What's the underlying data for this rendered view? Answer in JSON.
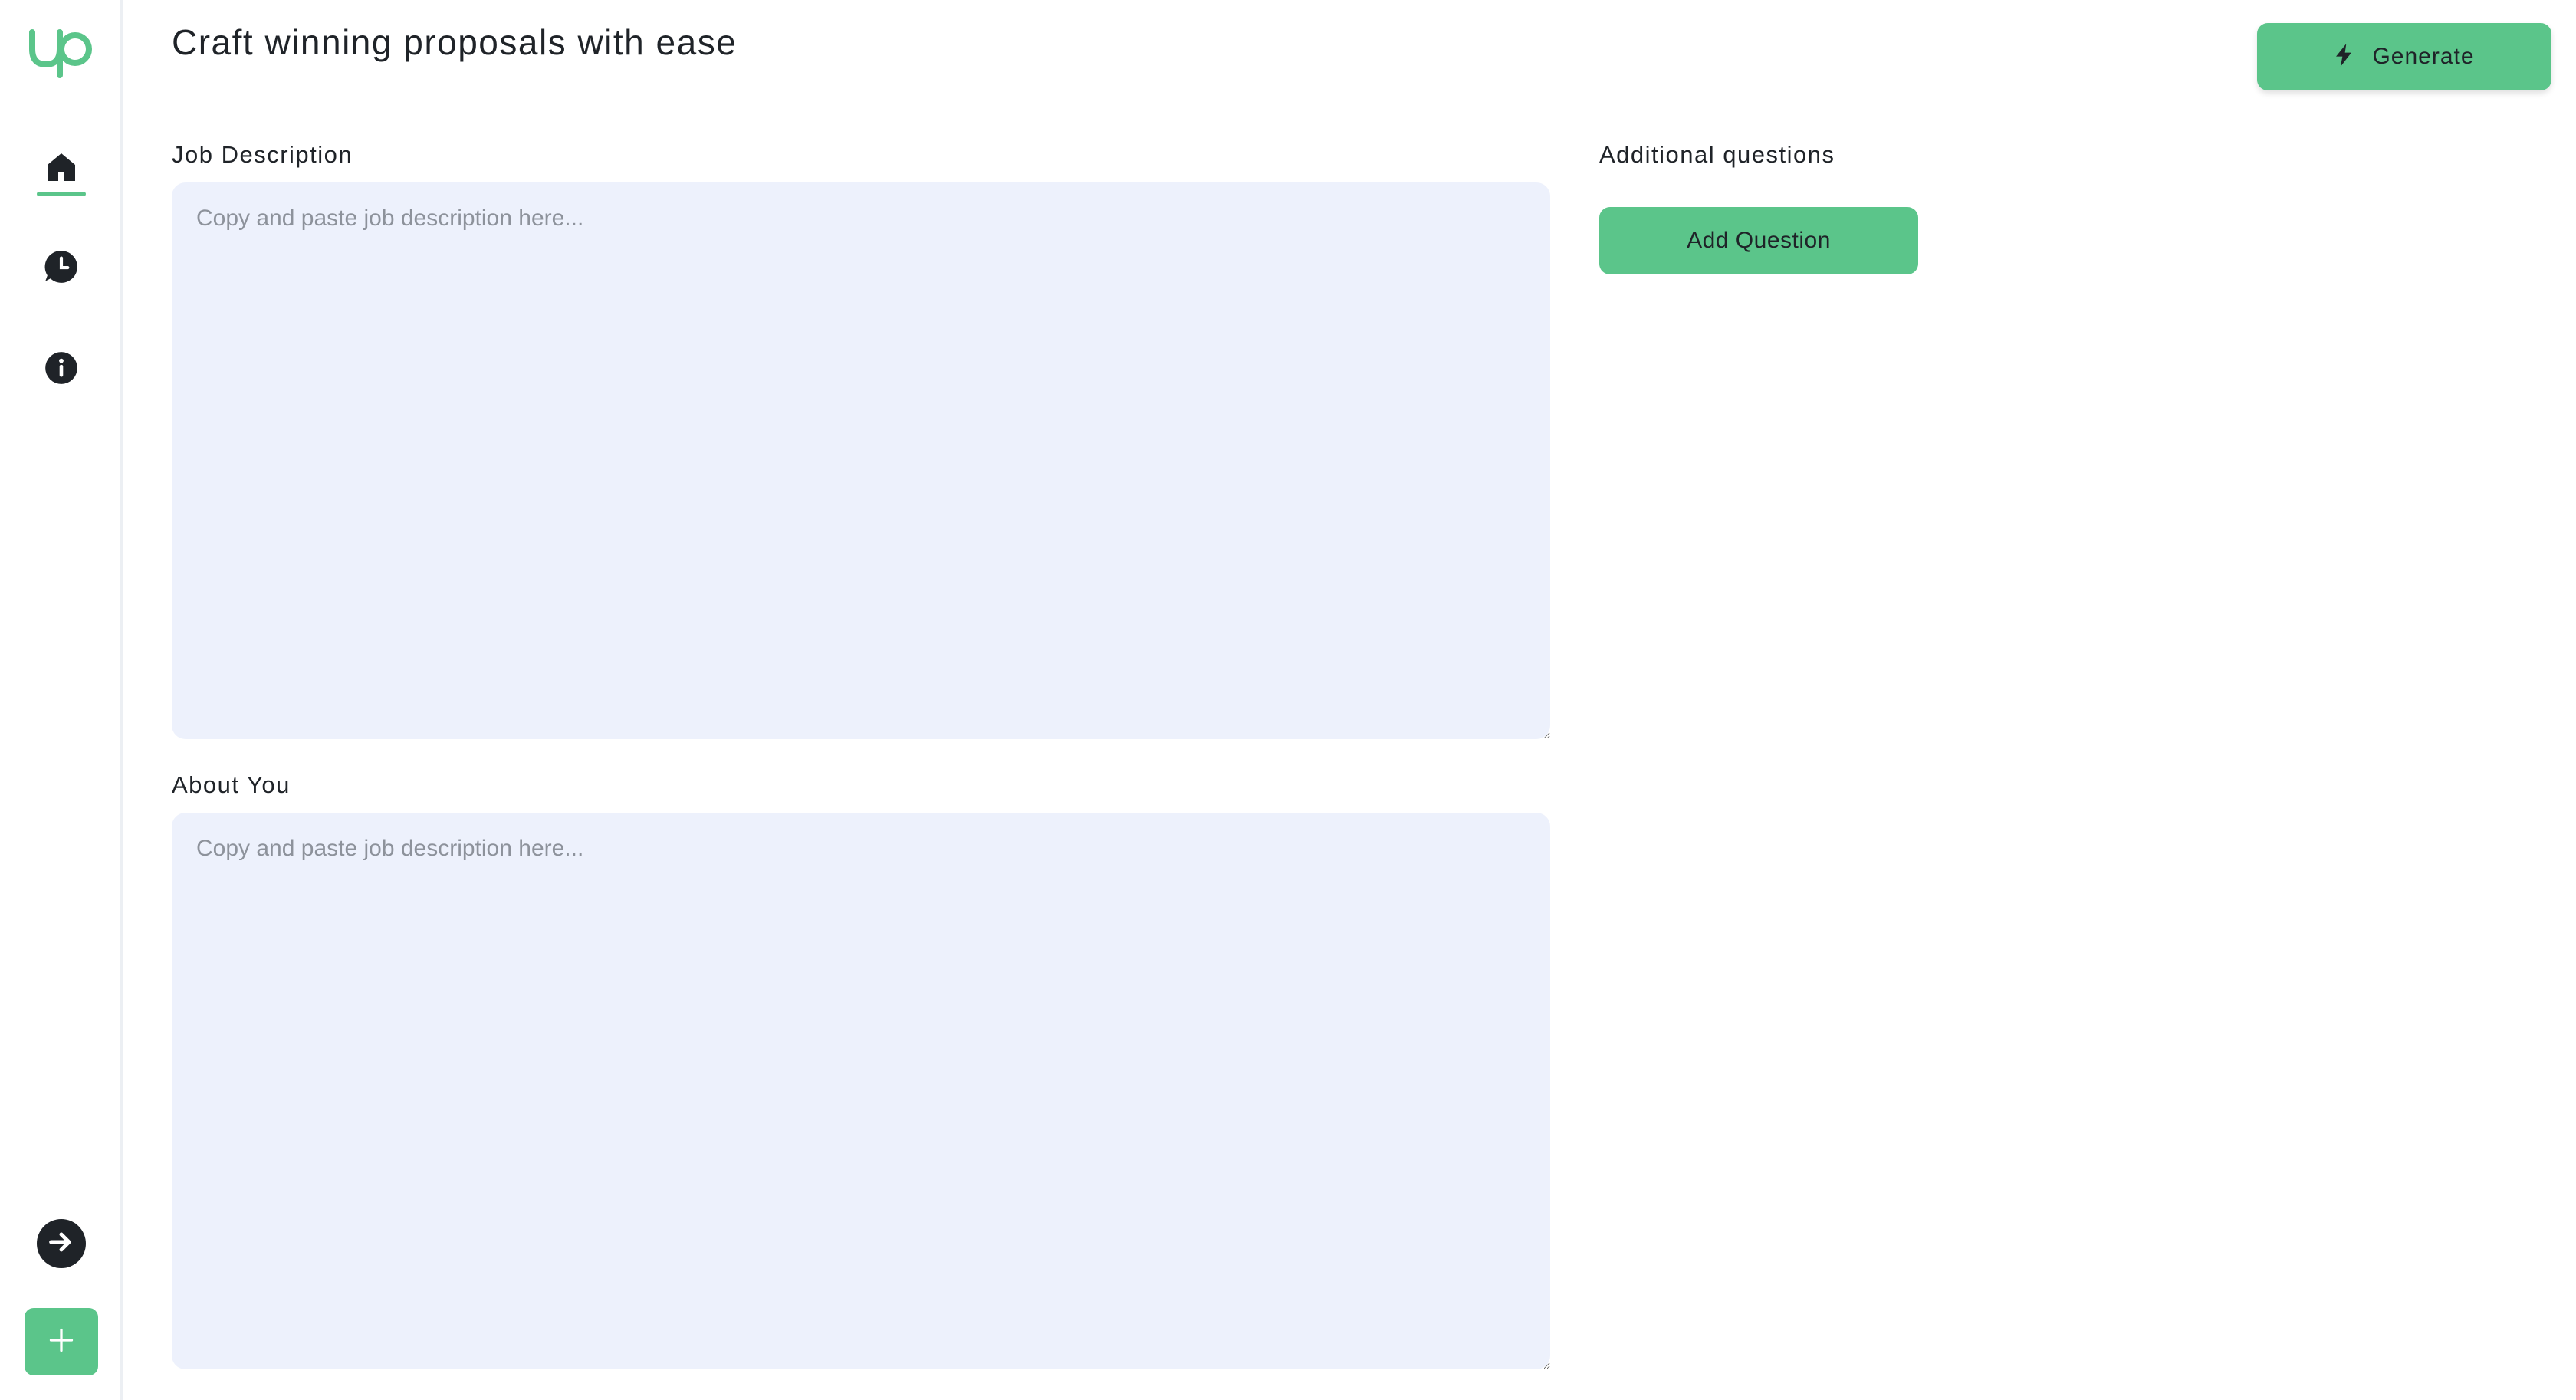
{
  "sidebar": {
    "logo_icon": "upwork-logo-icon",
    "items": [
      {
        "icon": "home-icon",
        "active": true
      },
      {
        "icon": "history-icon",
        "active": false
      },
      {
        "icon": "info-icon",
        "active": false
      }
    ],
    "bottom_actions": [
      {
        "icon": "arrow-right-circle-icon"
      },
      {
        "icon": "plus-icon"
      }
    ]
  },
  "header": {
    "title": "Craft winning proposals with ease",
    "generate_label": "Generate",
    "generate_icon": "lightning-bolt-icon"
  },
  "form": {
    "job_description": {
      "label": "Job Description",
      "placeholder": "Copy and paste job description here...",
      "value": ""
    },
    "about_you": {
      "label": "About You",
      "placeholder": "Copy and paste job description here...",
      "value": ""
    },
    "additional_questions": {
      "label": "Additional questions",
      "add_button_label": "Add Question"
    }
  },
  "colors": {
    "accent": "#5bc58a",
    "field_background": "#edf1fc",
    "text_dark": "#1f2328",
    "placeholder": "#8d929b"
  }
}
